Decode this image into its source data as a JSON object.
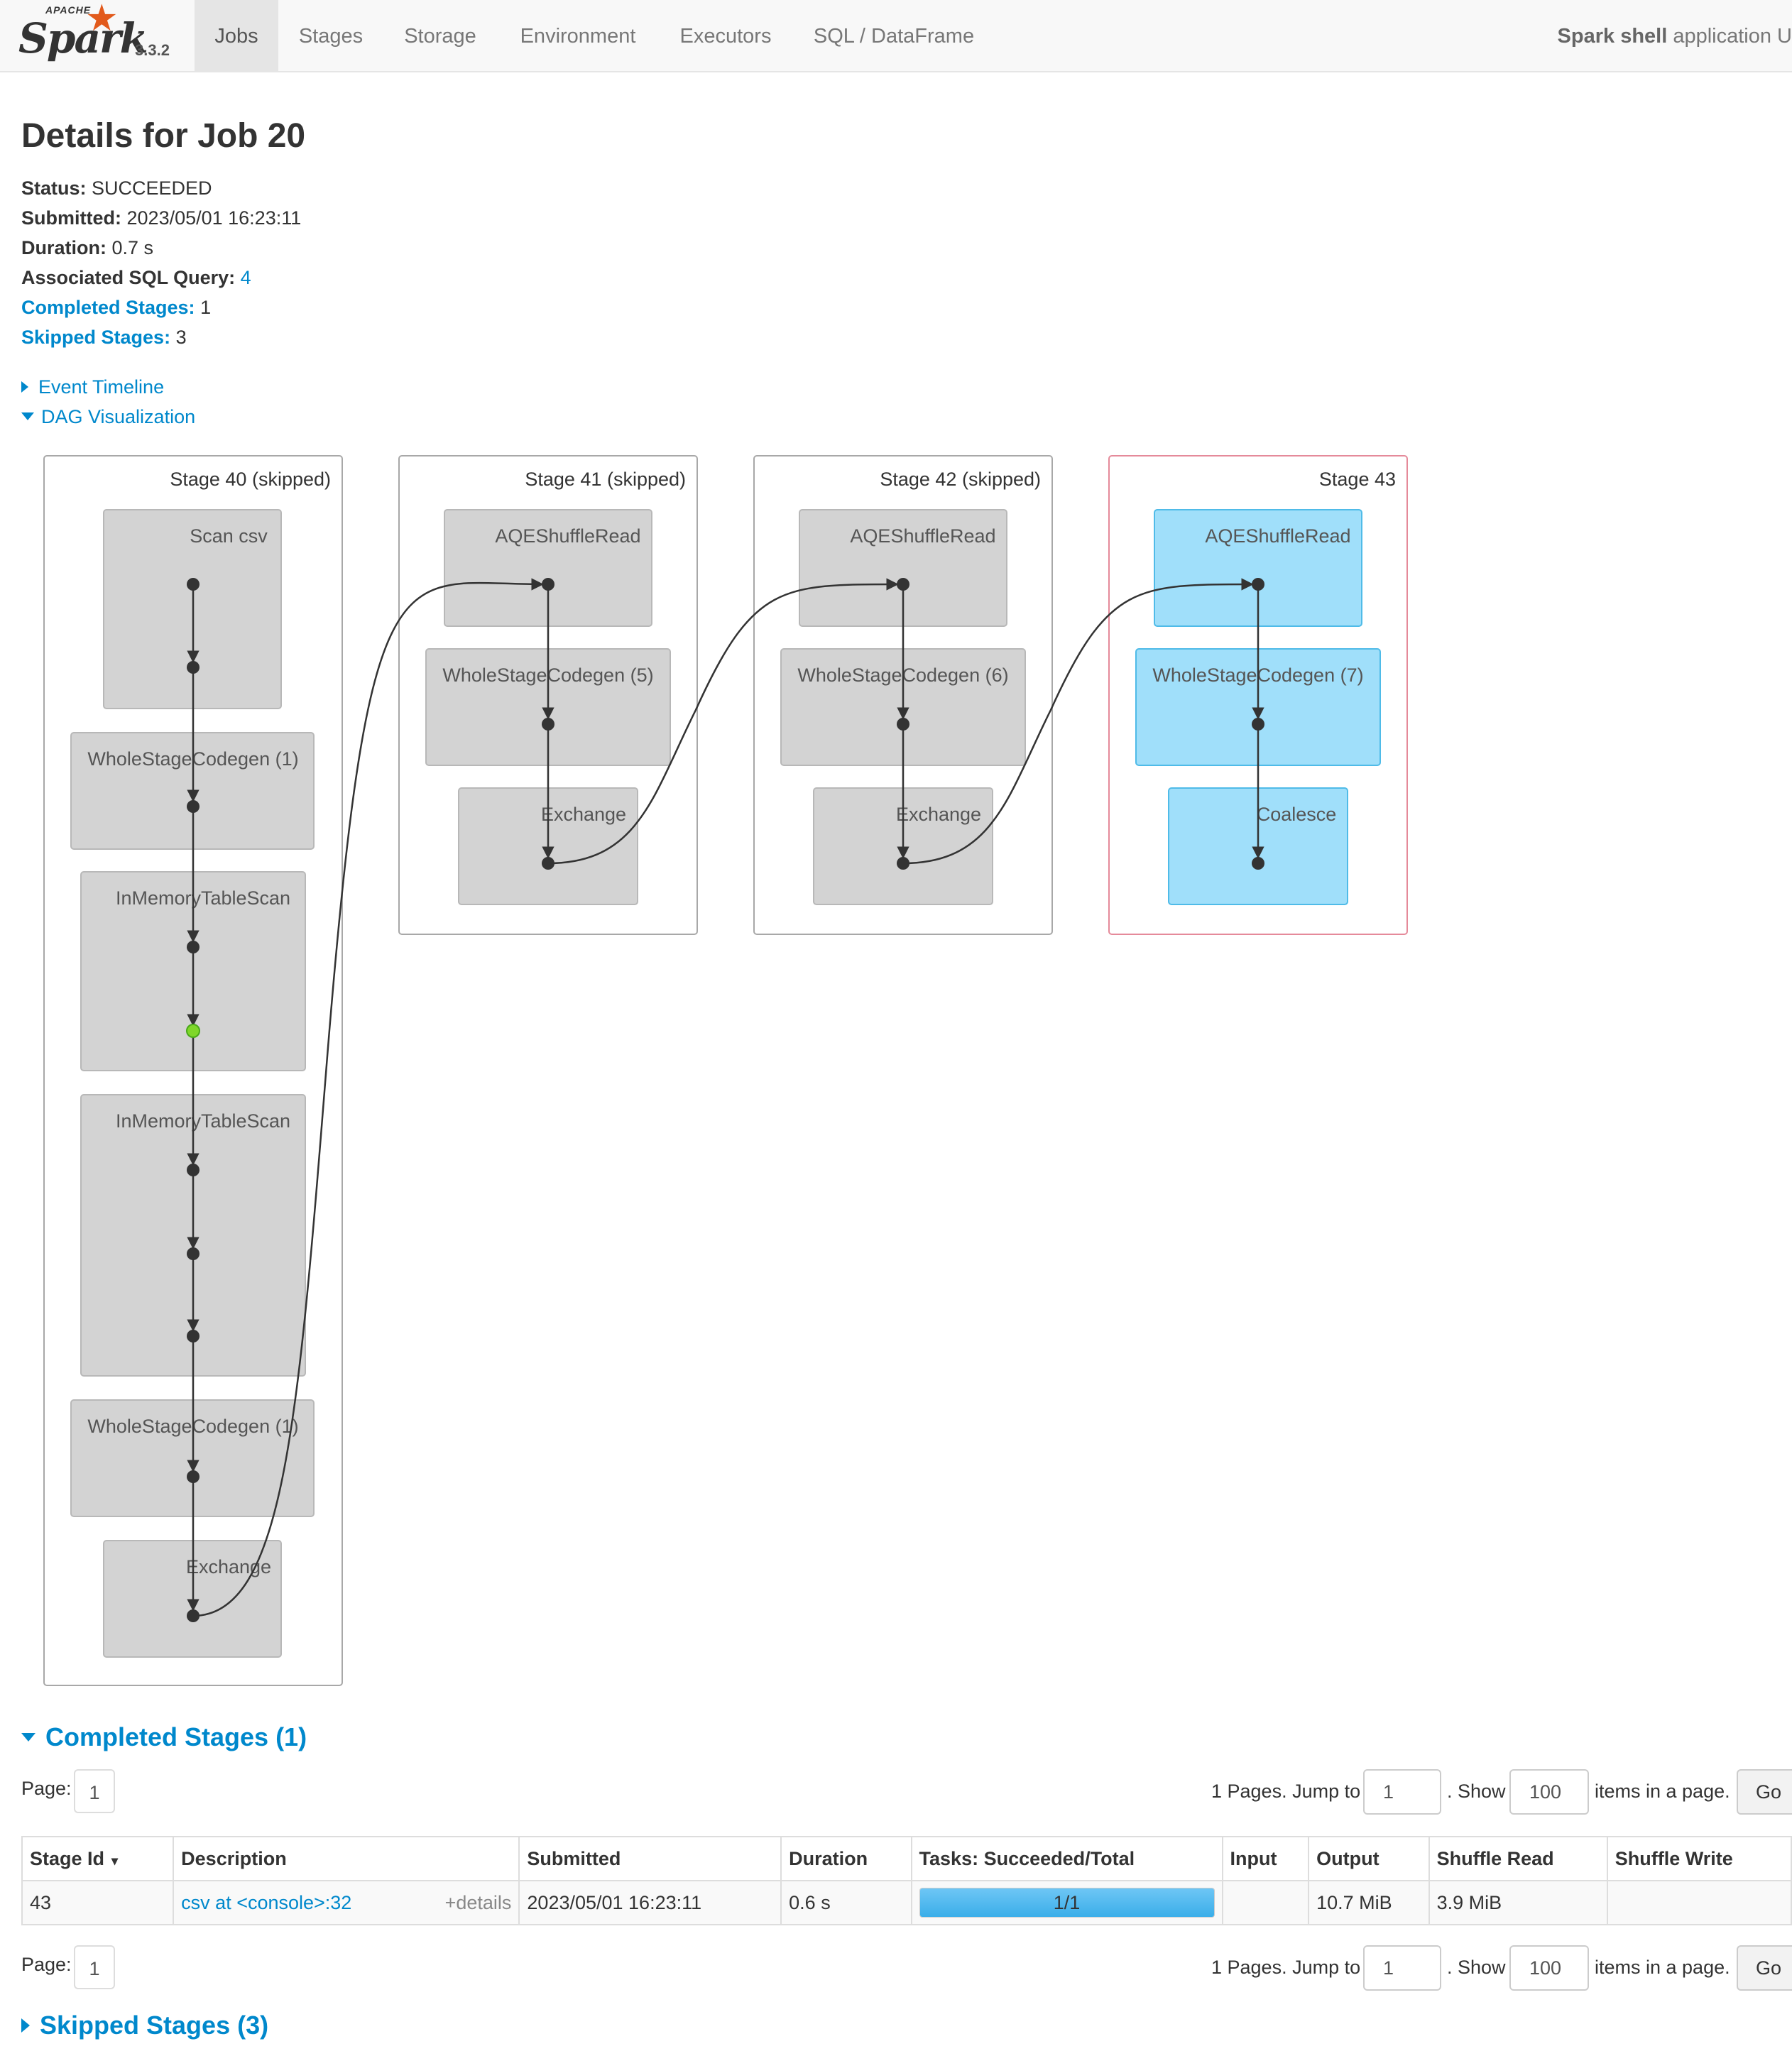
{
  "nav": {
    "brand_apache": "APACHE",
    "brand_name": "Spark",
    "version": "3.3.2",
    "tabs": [
      "Jobs",
      "Stages",
      "Storage",
      "Environment",
      "Executors",
      "SQL / DataFrame"
    ],
    "active_tab": "Jobs",
    "app_name_bold": "Spark shell",
    "app_name_rest": " application U"
  },
  "title": "Details for Job 20",
  "summary": {
    "status_label": "Status:",
    "status": "SUCCEEDED",
    "submitted_label": "Submitted:",
    "submitted": "2023/05/01 16:23:11",
    "duration_label": "Duration:",
    "duration": "0.7 s",
    "sql_label": "Associated SQL Query:",
    "sql": "4",
    "completed_label": "Completed Stages:",
    "completed": "1",
    "skipped_label": "Skipped Stages:",
    "skipped": "3"
  },
  "toggles": {
    "timeline": "Event Timeline",
    "dag": "DAG Visualization"
  },
  "dag": {
    "stages": [
      {
        "label": "Stage 40 (skipped)",
        "nodes": [
          "Scan csv",
          "WholeStageCodegen (1)",
          "InMemoryTableScan",
          "InMemoryTableScan",
          "WholeStageCodegen (1)",
          "Exchange"
        ]
      },
      {
        "label": "Stage 41 (skipped)",
        "nodes": [
          "AQEShuffleRead",
          "WholeStageCodegen (5)",
          "Exchange"
        ]
      },
      {
        "label": "Stage 42 (skipped)",
        "nodes": [
          "AQEShuffleRead",
          "WholeStageCodegen (6)",
          "Exchange"
        ]
      },
      {
        "label": "Stage 43",
        "nodes": [
          "AQEShuffleRead",
          "WholeStageCodegen (7)",
          "Coalesce"
        ]
      }
    ],
    "colors": {
      "skipped_fill": "#d3d3d3",
      "active_fill": "#a0dffa",
      "active_border": "#e58a9a",
      "cached_dot": "#7fd72a"
    }
  },
  "completed_section": "Completed Stages (1)",
  "skipped_section": "Skipped Stages (3)",
  "pager": {
    "page_label": "Page:",
    "page": "1",
    "pages_text": "1 Pages. Jump to",
    "jump_value": "1",
    "show_text": ". Show",
    "show_value": "100",
    "items_text": "items in a page.",
    "go": "Go"
  },
  "table": {
    "headers": [
      "Stage Id",
      "Description",
      "Submitted",
      "Duration",
      "Tasks: Succeeded/Total",
      "Input",
      "Output",
      "Shuffle Read",
      "Shuffle Write"
    ],
    "sort_icon": "▾",
    "row": {
      "stage_id": "43",
      "description": "csv at <console>:32",
      "details": "+details",
      "submitted": "2023/05/01 16:23:11",
      "duration": "0.6 s",
      "tasks": "1/1",
      "tasks_fraction": 1.0,
      "input": "",
      "output": "10.7 MiB",
      "shuffle_read": "3.9 MiB",
      "shuffle_write": ""
    }
  }
}
